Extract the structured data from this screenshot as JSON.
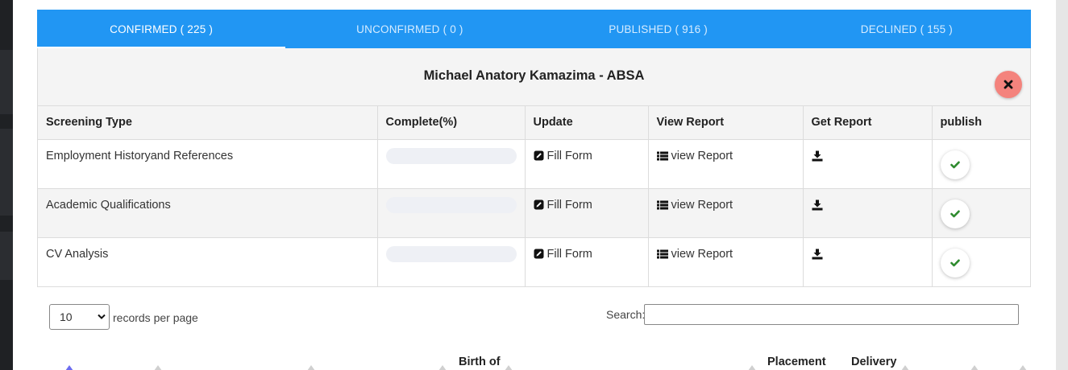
{
  "tabs": [
    {
      "label": "CONFIRMED ( 225 )",
      "active": true
    },
    {
      "label": "UNCONFIRMED ( 0 )",
      "active": false
    },
    {
      "label": "PUBLISHED ( 916 )",
      "active": false
    },
    {
      "label": "DECLINED ( 155 )",
      "active": false
    }
  ],
  "panel": {
    "title": "Michael Anatory Kamazima - ABSA",
    "close_icon": "close-icon"
  },
  "table": {
    "headers": [
      "Screening Type",
      "Complete(%)",
      "Update",
      "View Report",
      "Get Report",
      "publish"
    ],
    "rows": [
      {
        "type": "Employment Historyand References",
        "progress": 0,
        "update": "Fill Form",
        "view": "view Report"
      },
      {
        "type": "Academic Qualifications",
        "progress": 0,
        "update": "Fill Form",
        "view": "view Report"
      },
      {
        "type": "CV Analysis",
        "progress": 0,
        "update": "Fill Form",
        "view": "view Report"
      }
    ]
  },
  "pagination": {
    "selected": "10",
    "per_page_label": "records per page",
    "search_label": "Search:",
    "search_value": ""
  },
  "bottom_headers": {
    "birth": "Birth of",
    "placement": "Placement",
    "delivery": "Delivery"
  },
  "colors": {
    "tab_bar": "#2196f3",
    "close_button": "#f4837d",
    "check": "#2e8b2e"
  }
}
